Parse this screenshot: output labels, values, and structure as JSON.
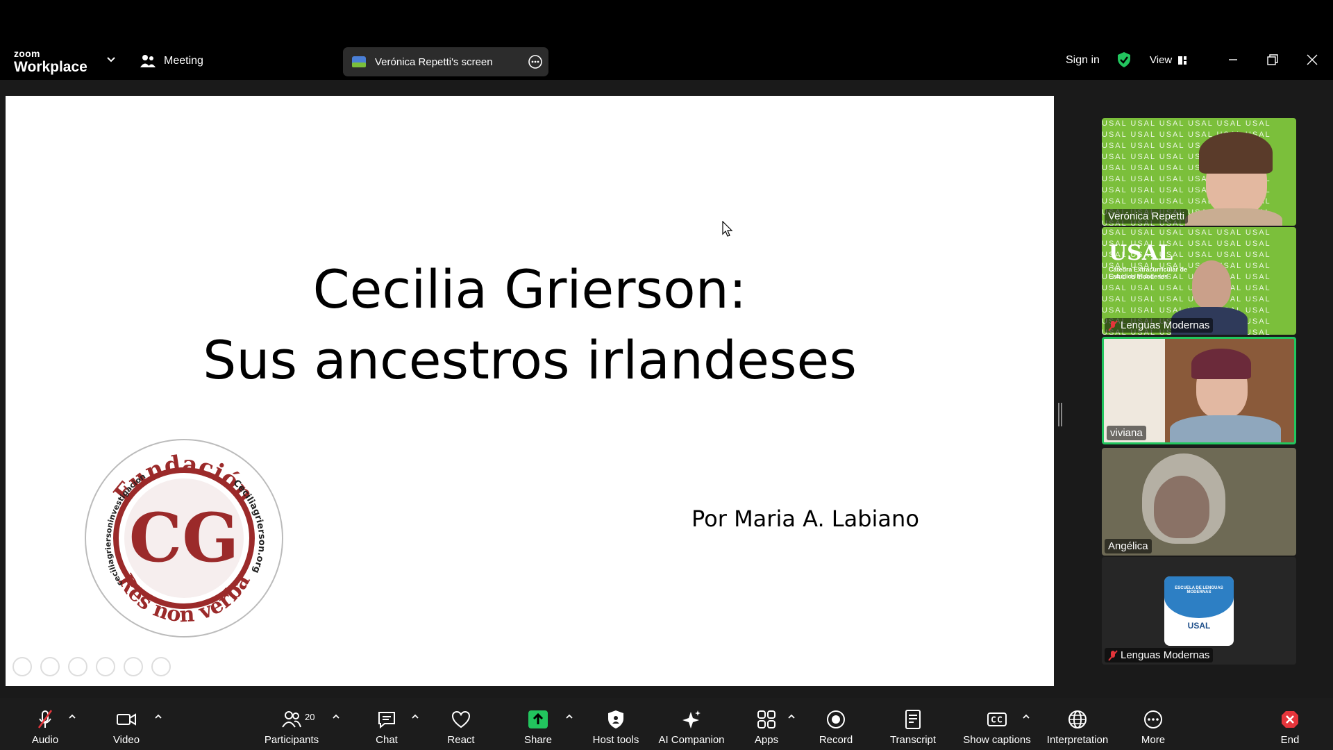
{
  "app": {
    "brand_top": "zoom",
    "brand_bottom": "Workplace",
    "meeting_label": "Meeting",
    "screen_share_label": "Verónica Repetti's screen",
    "sign_in": "Sign in",
    "view_label": "View"
  },
  "slide": {
    "title_line1": "Cecilia Grierson:",
    "title_line2": "Sus ancestros irlandeses",
    "author": "Por Maria A. Labiano",
    "logo": {
      "top_text": "Fundación",
      "monogram": "CG",
      "bottom_text": "Res non verba",
      "left_text": "ceciliagriersoninvestigacion",
      "right_text": "Ceciliagrierson.org"
    }
  },
  "participants_panel": {
    "tiles": [
      {
        "name": "Verónica Repetti",
        "muted": false,
        "active": false,
        "background_text": "USAL"
      },
      {
        "name": "Lenguas Modernas",
        "muted": true,
        "active": false,
        "background_text": "USAL",
        "sub_text": "Cátedra Extracurricular de Estudios Irlandeses"
      },
      {
        "name": "viviana",
        "muted": false,
        "active": true
      },
      {
        "name": "Angélica",
        "muted": false,
        "active": false
      },
      {
        "name": "Lenguas Modernas",
        "muted": true,
        "active": false,
        "avatar_text_top": "ESCUELA DE LENGUAS MODERNAS",
        "avatar_text_bottom": "USAL"
      }
    ]
  },
  "toolbar": {
    "audio": "Audio",
    "video": "Video",
    "participants": "Participants",
    "participants_count": "20",
    "chat": "Chat",
    "react": "React",
    "share": "Share",
    "host_tools": "Host tools",
    "ai_companion": "AI Companion",
    "apps": "Apps",
    "record": "Record",
    "transcript": "Transcript",
    "show_captions": "Show captions",
    "interpretation": "Interpretation",
    "more": "More",
    "end": "End"
  },
  "colors": {
    "share_green": "#22c55e",
    "end_red": "#e5353b",
    "logo_red": "#9b2a2a",
    "usal_green": "#7bbf3b",
    "active_border": "#22c55e"
  }
}
